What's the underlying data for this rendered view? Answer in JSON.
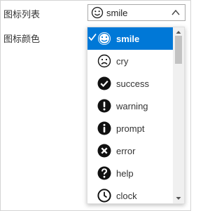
{
  "form": {
    "icon_list_label": "图标列表",
    "icon_color_label": "图标颜色"
  },
  "combo": {
    "selected_value": "smile",
    "selected_icon": "smile-icon"
  },
  "dropdown": {
    "items": [
      {
        "label": "smile",
        "icon": "smile-icon",
        "selected": true
      },
      {
        "label": "cry",
        "icon": "cry-icon",
        "selected": false
      },
      {
        "label": "success",
        "icon": "success-icon",
        "selected": false
      },
      {
        "label": "warning",
        "icon": "warning-icon",
        "selected": false
      },
      {
        "label": "prompt",
        "icon": "info-icon",
        "selected": false
      },
      {
        "label": "error",
        "icon": "error-icon",
        "selected": false
      },
      {
        "label": "help",
        "icon": "help-icon",
        "selected": false
      },
      {
        "label": "clock",
        "icon": "clock-icon",
        "selected": false
      }
    ]
  },
  "colors": {
    "selection": "#0078d7",
    "scroll_thumb": "#c2c2c2"
  }
}
